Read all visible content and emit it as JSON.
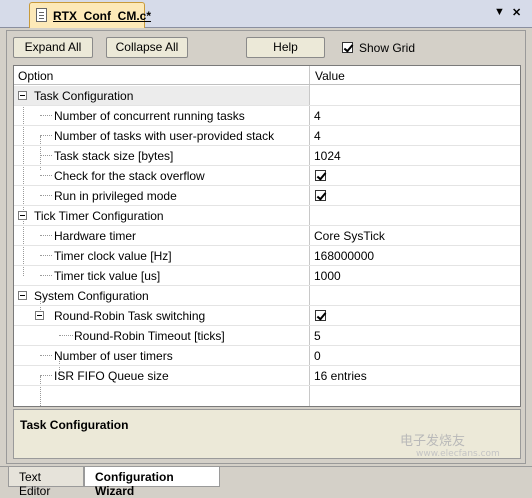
{
  "document_tab": {
    "title": "RTX_Conf_CM.c*"
  },
  "toolbar": {
    "expand_all": "Expand All",
    "collapse_all": "Collapse All",
    "help": "Help",
    "show_grid": "Show Grid",
    "show_grid_checked": true
  },
  "table": {
    "headers": {
      "option": "Option",
      "value": "Value"
    },
    "rows": [
      {
        "label": "Task Configuration",
        "value": "",
        "level": 0
      },
      {
        "label": "Number of concurrent running tasks",
        "value": "4",
        "level": 1
      },
      {
        "label": "Number of tasks with user-provided stack",
        "value": "4",
        "level": 1
      },
      {
        "label": "Task stack size [bytes]",
        "value": "1024",
        "level": 1
      },
      {
        "label": "Check for the stack overflow",
        "value": "",
        "level": 1,
        "checked": true
      },
      {
        "label": "Run in privileged mode",
        "value": "",
        "level": 1,
        "checked": true
      },
      {
        "label": "Tick Timer Configuration",
        "value": "",
        "level": 0
      },
      {
        "label": "Hardware timer",
        "value": "Core SysTick",
        "level": 1
      },
      {
        "label": "Timer clock value [Hz]",
        "value": "168000000",
        "level": 1
      },
      {
        "label": "Timer tick value [us]",
        "value": "1000",
        "level": 1
      },
      {
        "label": "System Configuration",
        "value": "",
        "level": 0
      },
      {
        "label": "Round-Robin Task switching",
        "value": "",
        "level": 1,
        "checked": true
      },
      {
        "label": "Round-Robin Timeout [ticks]",
        "value": "5",
        "level": 2
      },
      {
        "label": "Number of user timers",
        "value": "0",
        "level": 1
      },
      {
        "label": "ISR FIFO Queue size",
        "value": "16 entries",
        "level": 1
      }
    ]
  },
  "description": {
    "title": "Task Configuration"
  },
  "bottom_tabs": [
    {
      "label": "Text Editor",
      "active": false
    },
    {
      "label": "Configuration Wizard",
      "active": true
    }
  ],
  "watermark": {
    "main": "电子发烧友",
    "sub": "www.elecfans.com"
  }
}
